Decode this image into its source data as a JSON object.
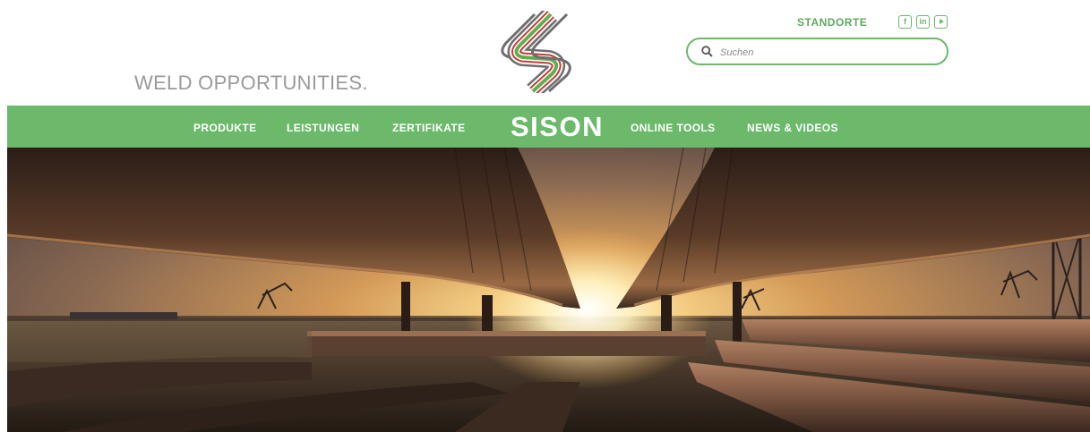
{
  "header": {
    "tagline": "WELD OPPORTUNITIES.",
    "standorte_label": "STANDORTE",
    "search_placeholder": "Suchen",
    "social_icons": [
      "facebook-icon",
      "linkedin-icon",
      "youtube-icon"
    ]
  },
  "nav": {
    "items": [
      "PRODUKTE",
      "LEISTUNGEN",
      "ZERTIFIKATE",
      "ONLINE TOOLS",
      "NEWS & VIDEOS"
    ],
    "brand": "SISON"
  },
  "colors": {
    "accent_green": "#6cb96c",
    "logo_red": "#c83a3a",
    "logo_green": "#5faf4f",
    "logo_gray": "#6e6e6e",
    "text_gray": "#9a9a9a"
  },
  "hero": {
    "image": "pipeline-sunset-photo"
  }
}
